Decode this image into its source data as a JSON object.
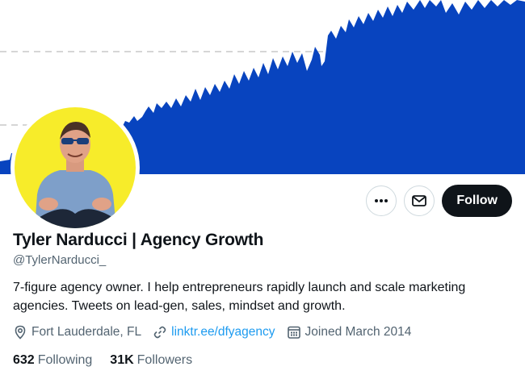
{
  "profile": {
    "display_name": "Tyler Narducci | Agency Growth",
    "handle": "@TylerNarducci_",
    "bio": "7-figure agency owner. I help entrepreneurs rapidly launch and scale marketing agencies. Tweets on lead-gen, sales, mindset and growth.",
    "location": "Fort Lauderdale, FL",
    "website": "linktr.ee/dfyagency",
    "joined": "Joined March 2014",
    "following_count": "632",
    "following_label": "Following",
    "followers_count": "31K",
    "followers_label": "Followers"
  },
  "actions": {
    "more_icon": "more-horizontal-icon",
    "message_icon": "envelope-icon",
    "follow_label": "Follow"
  },
  "banner": {
    "kind": "growth-area-chart",
    "fill_color": "#0844bf",
    "avatar_ring_color": "#f7ec2a"
  },
  "colors": {
    "text": "#0f1419",
    "secondary": "#536471",
    "link": "#1d9bf0",
    "follow_button": "#0f1419"
  }
}
